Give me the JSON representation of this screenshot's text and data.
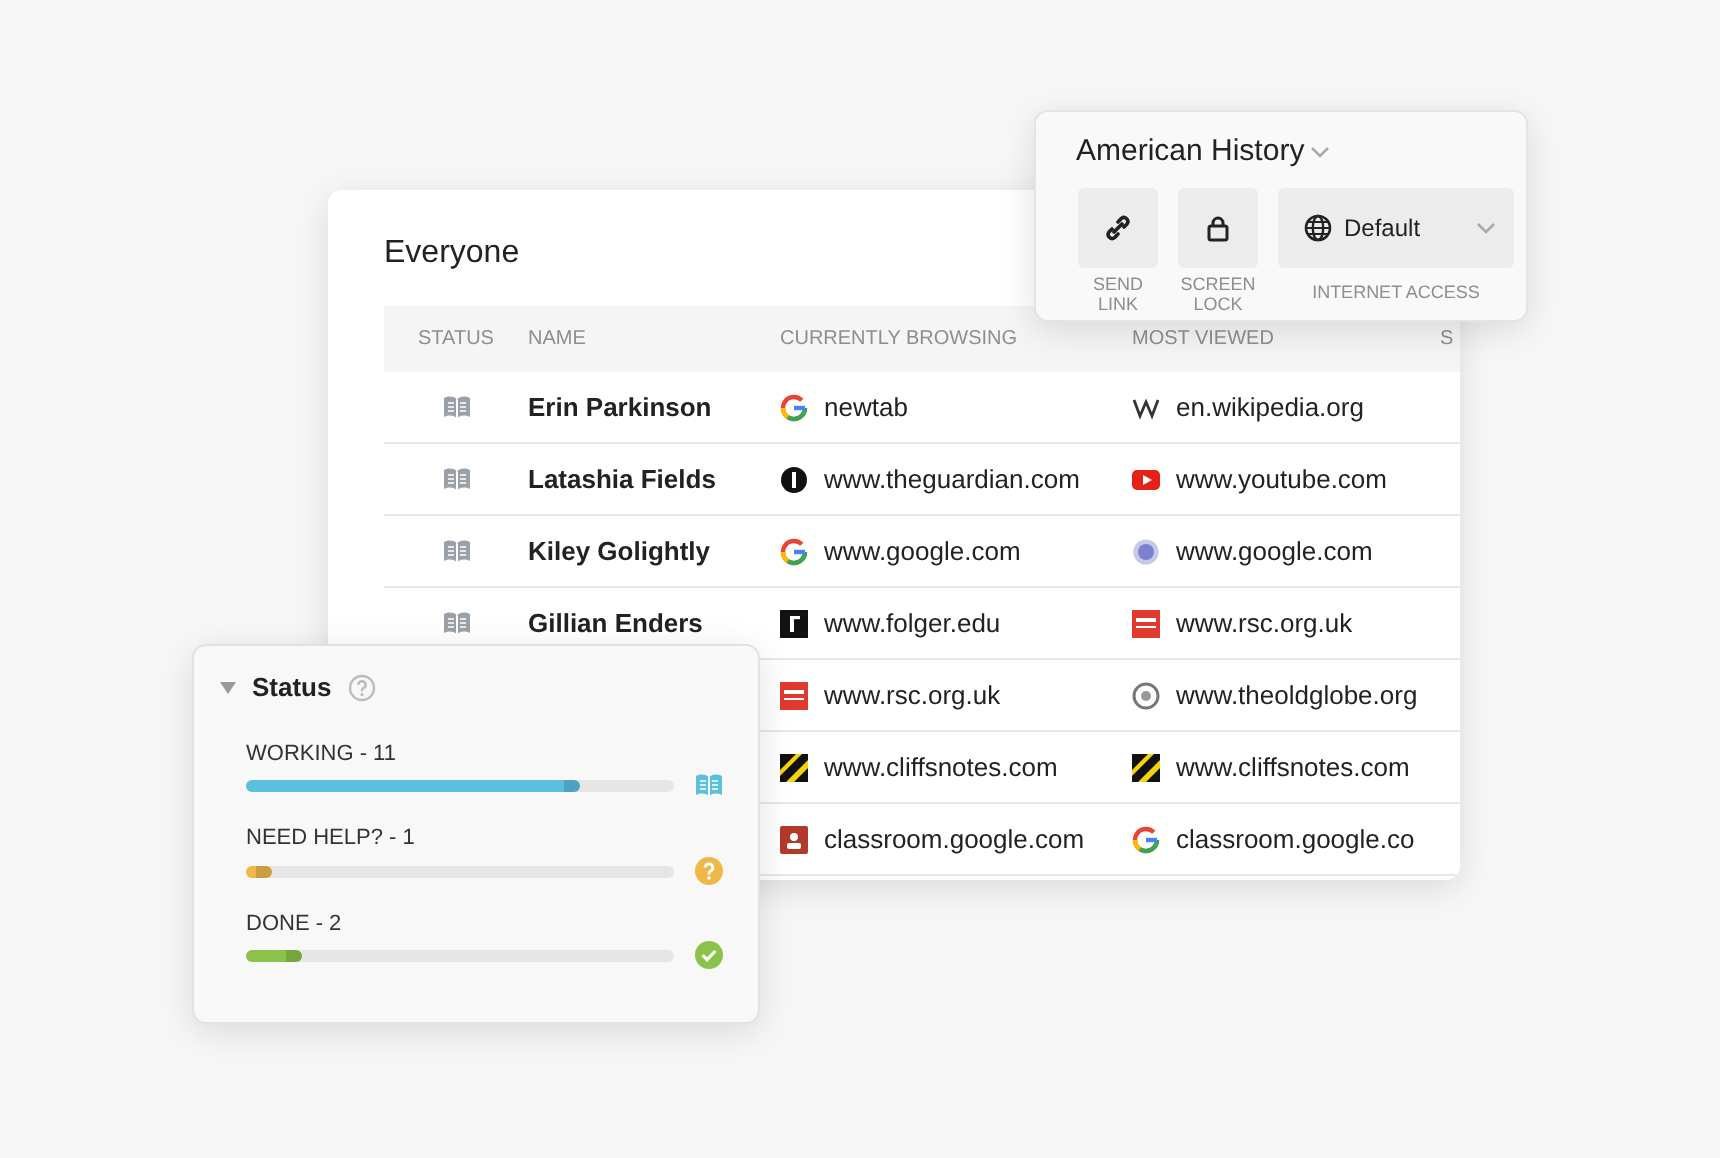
{
  "popover": {
    "title": "American History",
    "buttons": [
      {
        "kind": "link",
        "label": "SEND LINK"
      },
      {
        "kind": "lock",
        "label": "SCREEN LOCK"
      }
    ],
    "internet_access": {
      "value": "Default",
      "label": "INTERNET ACCESS"
    }
  },
  "table": {
    "title": "Everyone",
    "columns": [
      "STATUS",
      "NAME",
      "CURRENTLY BROWSING",
      "MOST VIEWED",
      "S"
    ],
    "rows": [
      {
        "kind": "working",
        "name": "Erin Parkinson",
        "browsing": {
          "kind": "google",
          "site": "newtab"
        },
        "most_viewed": {
          "kind": "wikipedia",
          "site": "en.wikipedia.org"
        }
      },
      {
        "kind": "working",
        "name": "Latashia Fields",
        "browsing": {
          "kind": "guardian",
          "site": "www.theguardian.com"
        },
        "most_viewed": {
          "kind": "youtube",
          "site": "www.youtube.com"
        }
      },
      {
        "kind": "working",
        "name": "Kiley Golightly",
        "browsing": {
          "kind": "google",
          "site": "www.google.com"
        },
        "most_viewed": {
          "kind": "globe",
          "site": "www.google.com"
        }
      },
      {
        "kind": "working",
        "name": "Gillian Enders",
        "browsing": {
          "kind": "folger",
          "site": "www.folger.edu"
        },
        "most_viewed": {
          "kind": "rsc",
          "site": "www.rsc.org.uk"
        }
      },
      {
        "browsing": {
          "kind": "rsc",
          "site": "www.rsc.org.uk"
        },
        "most_viewed": {
          "kind": "oldglobe",
          "site": "www.theoldglobe.org"
        }
      },
      {
        "browsing": {
          "kind": "cliffsnotes",
          "site": "www.cliffsnotes.com"
        },
        "most_viewed": {
          "kind": "cliffsnotes",
          "site": "www.cliffsnotes.com"
        }
      },
      {
        "browsing": {
          "kind": "classroom",
          "site": "classroom.google.com"
        },
        "most_viewed": {
          "kind": "google",
          "site": "classroom.google.co"
        }
      }
    ]
  },
  "status_panel": {
    "title": "Status",
    "expanded": true,
    "items": [
      {
        "kind": "working",
        "label": "WORKING - 11",
        "level": 0.78,
        "color": "#5bc0de"
      },
      {
        "kind": "help",
        "label": "NEED HELP? - 1",
        "level": 0.06,
        "color": "#f0b849"
      },
      {
        "kind": "done",
        "label": "DONE - 2",
        "level": 0.13,
        "color": "#8bc34a"
      }
    ]
  }
}
